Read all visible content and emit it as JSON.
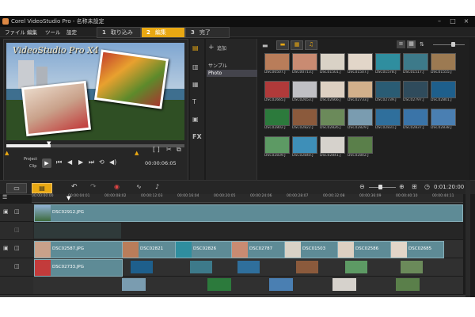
{
  "window": {
    "title": "Corel VideoStudio Pro - 名称未設定"
  },
  "menu": [
    "ファイル",
    "編集",
    "ツール",
    "設定"
  ],
  "steps": [
    {
      "num": "1",
      "label": "取り込み",
      "active": false
    },
    {
      "num": "2",
      "label": "編集",
      "active": true
    },
    {
      "num": "3",
      "label": "完了",
      "active": false
    }
  ],
  "preview": {
    "overlay_title": "VideoStudio Pro X4",
    "mode_project": "Project",
    "mode_clip": "Clip",
    "timecode": "00:00:06:05"
  },
  "library": {
    "add_label": "追加",
    "folders": [
      "サンプル",
      "Photo"
    ],
    "selected_folder": "Photo",
    "browse_label": "参照",
    "options_label": "オプション",
    "thumbs": [
      {
        "label": "DSC00507.J",
        "color": "#b97d5a"
      },
      {
        "label": "DSC00713.J",
        "color": "#c98b72"
      },
      {
        "label": "DSC01501.J",
        "color": "#d9d2c6"
      },
      {
        "label": "DSC01507.J",
        "color": "#e2d6c9"
      },
      {
        "label": "DSC01578.J",
        "color": "#2f8e9f"
      },
      {
        "label": "DSC01517.J",
        "color": "#3d7a8a"
      },
      {
        "label": "DSC01555.J",
        "color": "#9c7a52"
      },
      {
        "label": "DSC02665.J",
        "color": "#b03a3a"
      },
      {
        "label": "DSC02653.J",
        "color": "#c0c0c4"
      },
      {
        "label": "DSC02666.J",
        "color": "#ddd0c2"
      },
      {
        "label": "DSC02733.J",
        "color": "#d2b08b"
      },
      {
        "label": "DSC02739.J",
        "color": "#2a5c74"
      },
      {
        "label": "DSC02797.J",
        "color": "#2f4b5c"
      },
      {
        "label": "DSC02801.J",
        "color": "#1e5f8c"
      },
      {
        "label": "DSC02802.J",
        "color": "#2c7a3c"
      },
      {
        "label": "DSC02822.J",
        "color": "#8b5a3c"
      },
      {
        "label": "DSC02826.J",
        "color": "#6b8a5a"
      },
      {
        "label": "DSC02829.J",
        "color": "#7a9cb0"
      },
      {
        "label": "DSC02831.J",
        "color": "#2f6f9c"
      },
      {
        "label": "DSC02837.J",
        "color": "#3a74a8"
      },
      {
        "label": "DSC02838.J",
        "color": "#4a7fb2"
      },
      {
        "label": "DSC02839.J",
        "color": "#5d9a64"
      },
      {
        "label": "DSC02840.J",
        "color": "#3e8fb8"
      },
      {
        "label": "DSC02841.J",
        "color": "#d6d2cc"
      },
      {
        "label": "DSC02842.J",
        "color": "#5a7f4a"
      }
    ]
  },
  "timeline": {
    "timecode": "0:01:20:00",
    "ruler": [
      "00:00:00:00",
      "00:00:04:01",
      "00:00:08:02",
      "00:00:12:03",
      "00:00:16:04",
      "00:00:20:05",
      "00:00:24:06",
      "00:00:28:07",
      "00:00:32:08",
      "00:00:36:09",
      "00:00:40:10",
      "00:00:44:11"
    ],
    "track1_clip": "DSC02912.JPG",
    "track3_clips": [
      "DSC02587.JPG",
      "DSC02821",
      "DSC02826",
      "DSC02787",
      "DSC01503",
      "DSC02586",
      "DSC02685"
    ],
    "track4_clip": "DSC02733.JPG"
  }
}
